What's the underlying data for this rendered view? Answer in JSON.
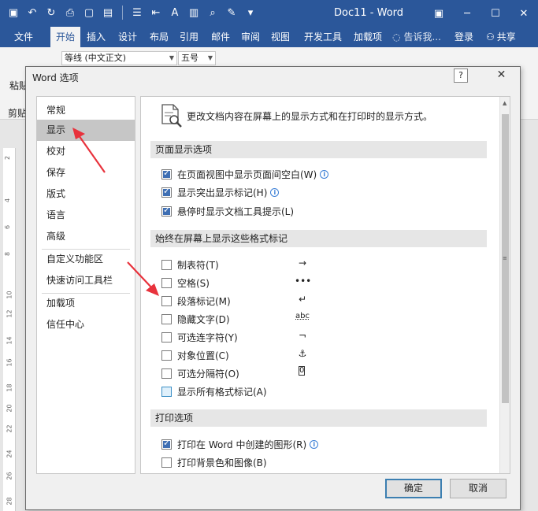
{
  "titlebar": {
    "doc_title": "Doc11 - Word",
    "accent": "#2b579a"
  },
  "ribbon_tabs": [
    "文件",
    "开始",
    "插入",
    "设计",
    "布局",
    "引用",
    "邮件",
    "审阅",
    "视图",
    "开发工具",
    "加载项"
  ],
  "ribbon": {
    "tell_me": "告诉我...",
    "login": "登录",
    "share": "共享",
    "font_name": "等线 (中文正文)",
    "font_size": "五号",
    "paste_label": "粘贴",
    "clipboard_label": "剪贴"
  },
  "vertical_ruler": [
    "2",
    "4",
    "6",
    "8",
    "10",
    "12",
    "14",
    "16",
    "18",
    "20",
    "22",
    "24",
    "26",
    "28"
  ],
  "dialog": {
    "title": "Word 选项",
    "help": "?",
    "close": "✕",
    "nav_items": [
      "常规",
      "显示",
      "校对",
      "保存",
      "版式",
      "语言",
      "高级",
      "自定义功能区",
      "快速访问工具栏",
      "加载项",
      "信任中心"
    ],
    "selected_nav": "显示",
    "description": "更改文档内容在屏幕上的显示方式和在打印时的显示方式。",
    "sections": {
      "page_display": "页面显示选项",
      "format_marks": "始终在屏幕上显示这些格式标记",
      "print": "打印选项"
    },
    "page_display_options": [
      {
        "label": "在页面视图中显示页面间空白(W)",
        "checked": true,
        "info": true
      },
      {
        "label": "显示突出显示标记(H)",
        "checked": true,
        "info": true
      },
      {
        "label": "悬停时显示文档工具提示(L)",
        "checked": true,
        "info": false
      }
    ],
    "format_mark_options": [
      {
        "label": "制表符(T)",
        "checked": false,
        "glyph": "→"
      },
      {
        "label": "空格(S)",
        "checked": false,
        "glyph": "•••"
      },
      {
        "label": "段落标记(M)",
        "checked": false,
        "glyph": "↵"
      },
      {
        "label": "隐藏文字(D)",
        "checked": false,
        "glyph": "abc"
      },
      {
        "label": "可选连字符(Y)",
        "checked": false,
        "glyph": "¬"
      },
      {
        "label": "对象位置(C)",
        "checked": false,
        "glyph": "⚓"
      },
      {
        "label": "可选分隔符(O)",
        "checked": false,
        "glyph": "0"
      },
      {
        "label": "显示所有格式标记(A)",
        "checked": false,
        "glyph": ""
      }
    ],
    "print_options": [
      {
        "label": "打印在 Word 中创建的图形(R)",
        "checked": true,
        "info": true
      },
      {
        "label": "打印背景色和图像(B)",
        "checked": false,
        "info": false
      }
    ],
    "ok": "确定",
    "cancel": "取消"
  },
  "annotation_color": "#e8323c"
}
